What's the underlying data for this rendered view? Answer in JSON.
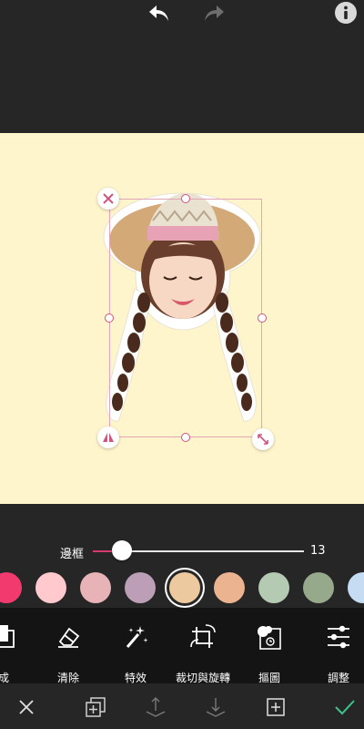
{
  "icons": {
    "undo": "undo-icon",
    "redo": "redo-icon",
    "info": "info-icon",
    "delete": "close-icon",
    "mirror": "flip-icon",
    "resize": "resize-icon"
  },
  "slider": {
    "label": "邊框",
    "value": "13",
    "level": 0.14
  },
  "colors": {
    "accent": "#d63a6a",
    "canvas_bg": "#fff5cc",
    "confirm": "#3fc38a",
    "swatches": [
      "#f23a6e",
      "#ffc9cd",
      "#e7b3b6",
      "#bd9eb7",
      "#ecc99e",
      "#ebb38f",
      "#b5cab2",
      "#96a98a",
      "#c6dcf2"
    ],
    "selected_swatch": 4
  },
  "tools": [
    {
      "label": "成",
      "icon": "layer-icon"
    },
    {
      "label": "清除",
      "icon": "eraser-icon"
    },
    {
      "label": "特效",
      "icon": "magic-wand-icon"
    },
    {
      "label": "裁切與旋轉",
      "icon": "crop-rotate-icon"
    },
    {
      "label": "摳圖",
      "icon": "cutout-icon"
    },
    {
      "label": "調整",
      "icon": "sliders-icon"
    }
  ],
  "actions": [
    {
      "name": "cancel",
      "icon": "close-icon"
    },
    {
      "name": "duplicate",
      "icon": "duplicate-icon"
    },
    {
      "name": "bring-forward",
      "icon": "layer-up-icon"
    },
    {
      "name": "send-backward",
      "icon": "layer-down-icon"
    },
    {
      "name": "add",
      "icon": "add-icon"
    },
    {
      "name": "confirm",
      "icon": "checkmark-icon"
    }
  ]
}
